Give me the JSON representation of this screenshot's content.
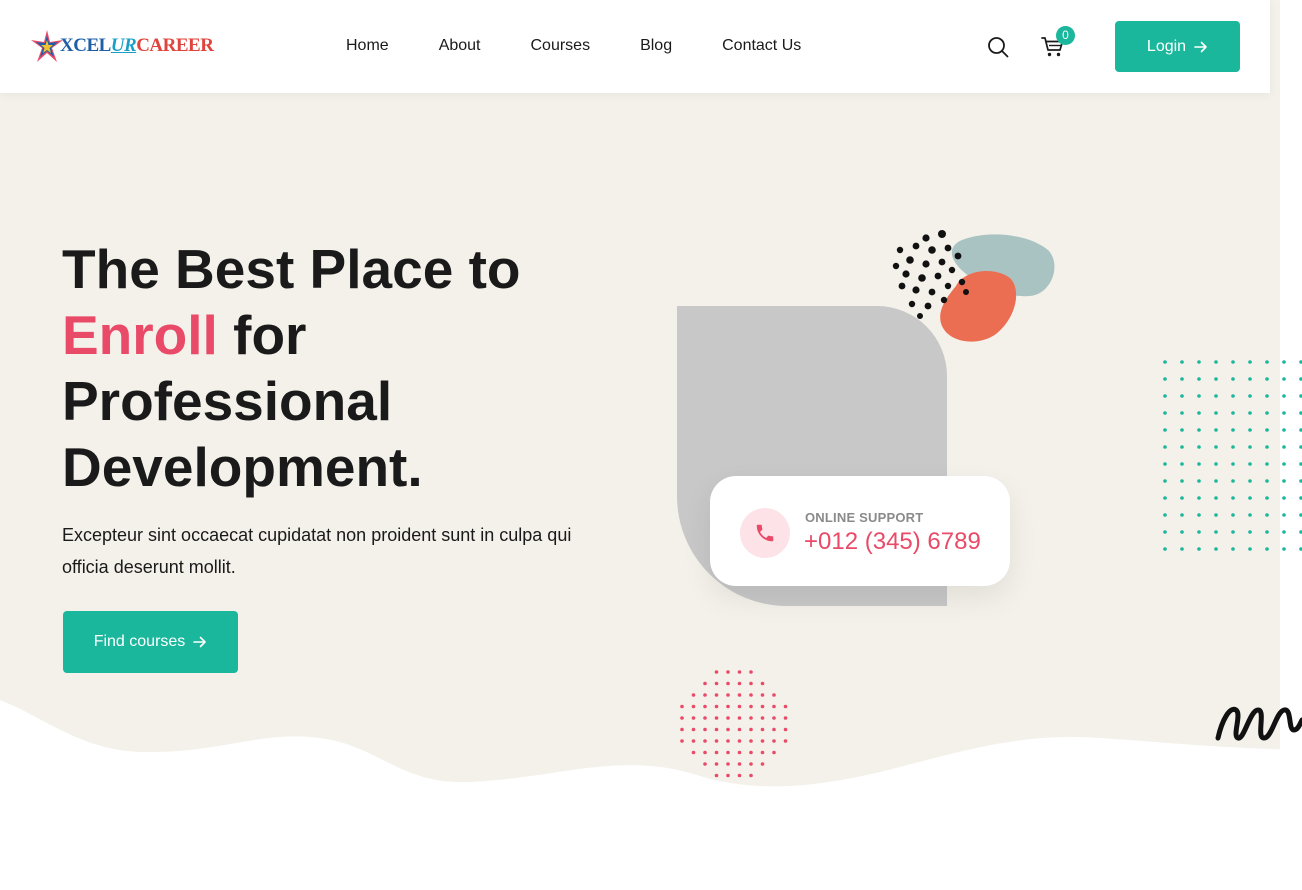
{
  "header": {
    "logo": {
      "part1": "XCEL",
      "part2": "UR",
      "part3": "CAREER"
    },
    "nav": [
      {
        "label": "Home"
      },
      {
        "label": "About"
      },
      {
        "label": "Courses"
      },
      {
        "label": "Blog"
      },
      {
        "label": "Contact Us"
      }
    ],
    "cart_count": "0",
    "login_label": "Login"
  },
  "hero": {
    "title_line1": "The Best Place to",
    "title_accent": "Enroll",
    "title_after_accent": " for",
    "title_line3": "Professional",
    "title_line4": "Development.",
    "description": "Excepteur sint occaecat cupidatat non proident sunt in culpa qui officia deserunt mollit.",
    "cta_label": "Find courses"
  },
  "support": {
    "label": "ONLINE SUPPORT",
    "phone": "+012 (345) 6789"
  },
  "colors": {
    "accent_teal": "#1ab79c",
    "accent_pink": "#e94a67",
    "hero_bg": "#f4f1ea"
  }
}
